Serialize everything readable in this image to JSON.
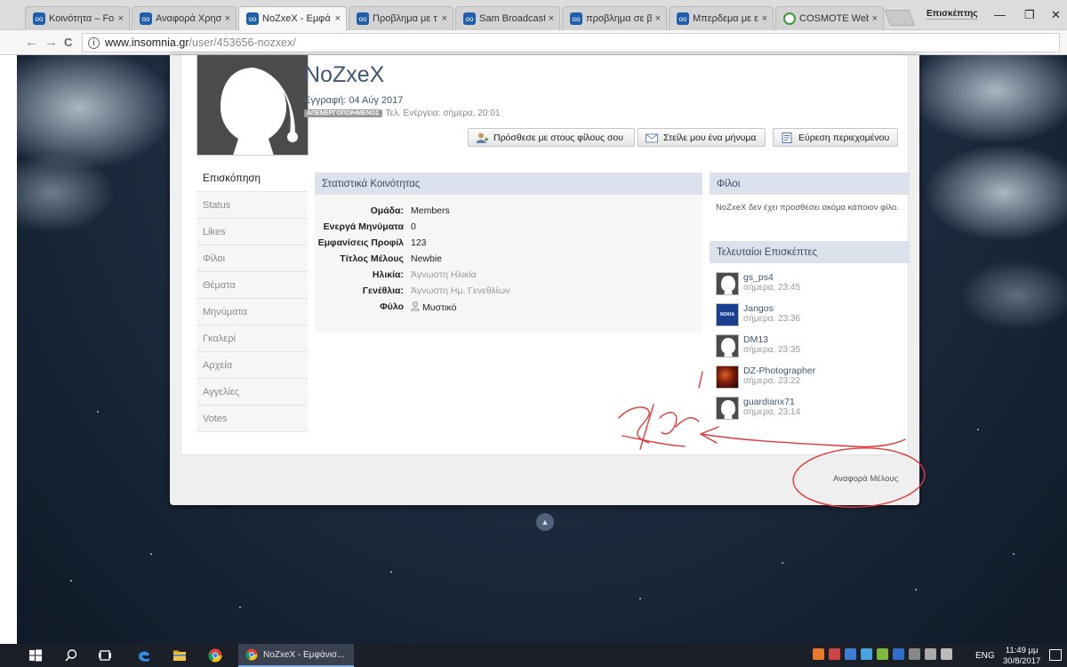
{
  "browser": {
    "tabs": [
      {
        "label": "Κοινότητα – Fo"
      },
      {
        "label": "Αναφορά Χρησ"
      },
      {
        "label": "NoZxeX - Εμφά"
      },
      {
        "label": "Προβλημα με τ"
      },
      {
        "label": "Sam Broadcaste"
      },
      {
        "label": "προβλημα σε β"
      },
      {
        "label": "Μπερδεμα με ε"
      },
      {
        "label": "COSMOTE Web"
      }
    ],
    "tab_close": "×",
    "profile_name": "Επισκέπτης",
    "win_min": "—",
    "win_max": "❐",
    "win_close": "✕",
    "back": "←",
    "forward": "→",
    "reload": "C",
    "info": "i",
    "url_host": "www.insomnia.gr",
    "url_path": "/user/453656-nozxex/"
  },
  "profile": {
    "username": "NoZxeX",
    "joined": "Εγγραφή: 04 Αύγ 2017",
    "status_badge": "ΑΠΕΝΕΡΓΟΠΟΙΗΜΕΝΟΣ",
    "last_active": "Τελ. Ενέργεια: σήμερα, 20:01",
    "buttons": {
      "add_friend": "Πρόσθεσε με στους φίλους σου",
      "send_message": "Στείλε μου ένα μήνυμα",
      "find_content": "Εύρεση περιεχομένου"
    }
  },
  "sidenav": {
    "items": [
      {
        "label": "Επισκόπηση"
      },
      {
        "label": "Status"
      },
      {
        "label": "Likes"
      },
      {
        "label": "Φίλοι"
      },
      {
        "label": "Θέματα"
      },
      {
        "label": "Μηνύματα"
      },
      {
        "label": "Γκαλερί"
      },
      {
        "label": "Αρχεία"
      },
      {
        "label": "Αγγελίες"
      },
      {
        "label": "Votes"
      }
    ]
  },
  "stats": {
    "title": "Στατιστικά Κοινότητας",
    "rows": [
      {
        "key": "Ομάδα:",
        "value": "Members"
      },
      {
        "key": "Ενεργά Μηνύματα",
        "value": "0"
      },
      {
        "key": "Εμφανίσεις Προφίλ",
        "value": "123"
      },
      {
        "key": "Τίτλος Μέλους",
        "value": "Newbie"
      },
      {
        "key": "Ηλικία:",
        "value": "Άγνωστη Ηλικία"
      },
      {
        "key": "Γενέθλια:",
        "value": "Άγνωστη Ημ. Γενεθλίων"
      },
      {
        "key": "Φύλο",
        "value": "Μυστικό"
      }
    ]
  },
  "friends": {
    "title": "Φίλοι",
    "empty_text": "NoZxeX δεν έχει προσθέσει ακόμα κάποιον φίλο."
  },
  "visitors": {
    "title": "Τελευταίοι Επισκέπτες",
    "items": [
      {
        "name": "gs_ps4",
        "time": "σήμερα, 23:45"
      },
      {
        "name": "Jangos",
        "time": "σήμερα, 23:36",
        "avatar_text": "NOKIA"
      },
      {
        "name": "DM13",
        "time": "σήμερα, 23:35"
      },
      {
        "name": "DZ-Photographer",
        "time": "σήμερα, 23:22"
      },
      {
        "name": "guardianx71",
        "time": "σήμερα, 23:14"
      }
    ]
  },
  "report_link": "Αναφορά Μέλους",
  "scroll_top": "▲",
  "taskbar": {
    "app_label": "NoZxeX - Εμφάνισ...",
    "language": "ENG",
    "time": "11:49 μμ",
    "date": "30/8/2017"
  },
  "colors": {
    "link": "#3d5775",
    "panel_header": "#dbe2ec",
    "annotation": "#e0383c"
  }
}
